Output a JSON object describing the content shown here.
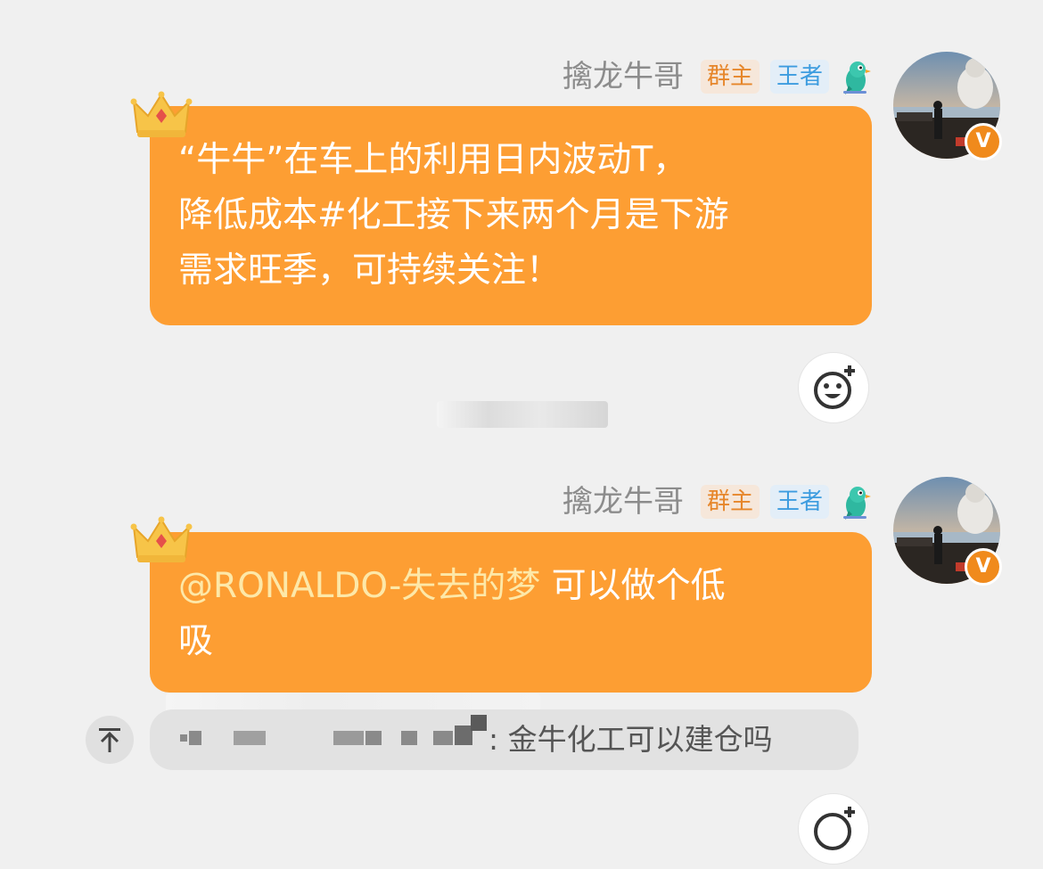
{
  "messages": [
    {
      "sender": "擒龙牛哥",
      "badges": [
        "群主",
        "王者"
      ],
      "lines": [
        "“牛牛”在车上的利用日内波动T，",
        "降低成本#化工接下来两个月是下游",
        "需求旺季，可持续关注！"
      ]
    },
    {
      "sender": "擒龙牛哥",
      "badges": [
        "群主",
        "王者"
      ],
      "mention": "@RONALDO-失去的梦",
      "line1_rest": " 可以做个低",
      "line2": "吸"
    }
  ],
  "quote": {
    "text": ": 金牛化工可以建仓吗"
  },
  "icons": {
    "crown": "crown-icon",
    "bird": "bird-icon",
    "verified": "verified-v-icon",
    "reaction": "add-emoji-icon",
    "scroll_up": "arrow-up-icon"
  },
  "colors": {
    "bubble": "#fd9e33",
    "background": "#f0f0f0",
    "mention": "#fde8a8"
  },
  "verified_label": "V"
}
